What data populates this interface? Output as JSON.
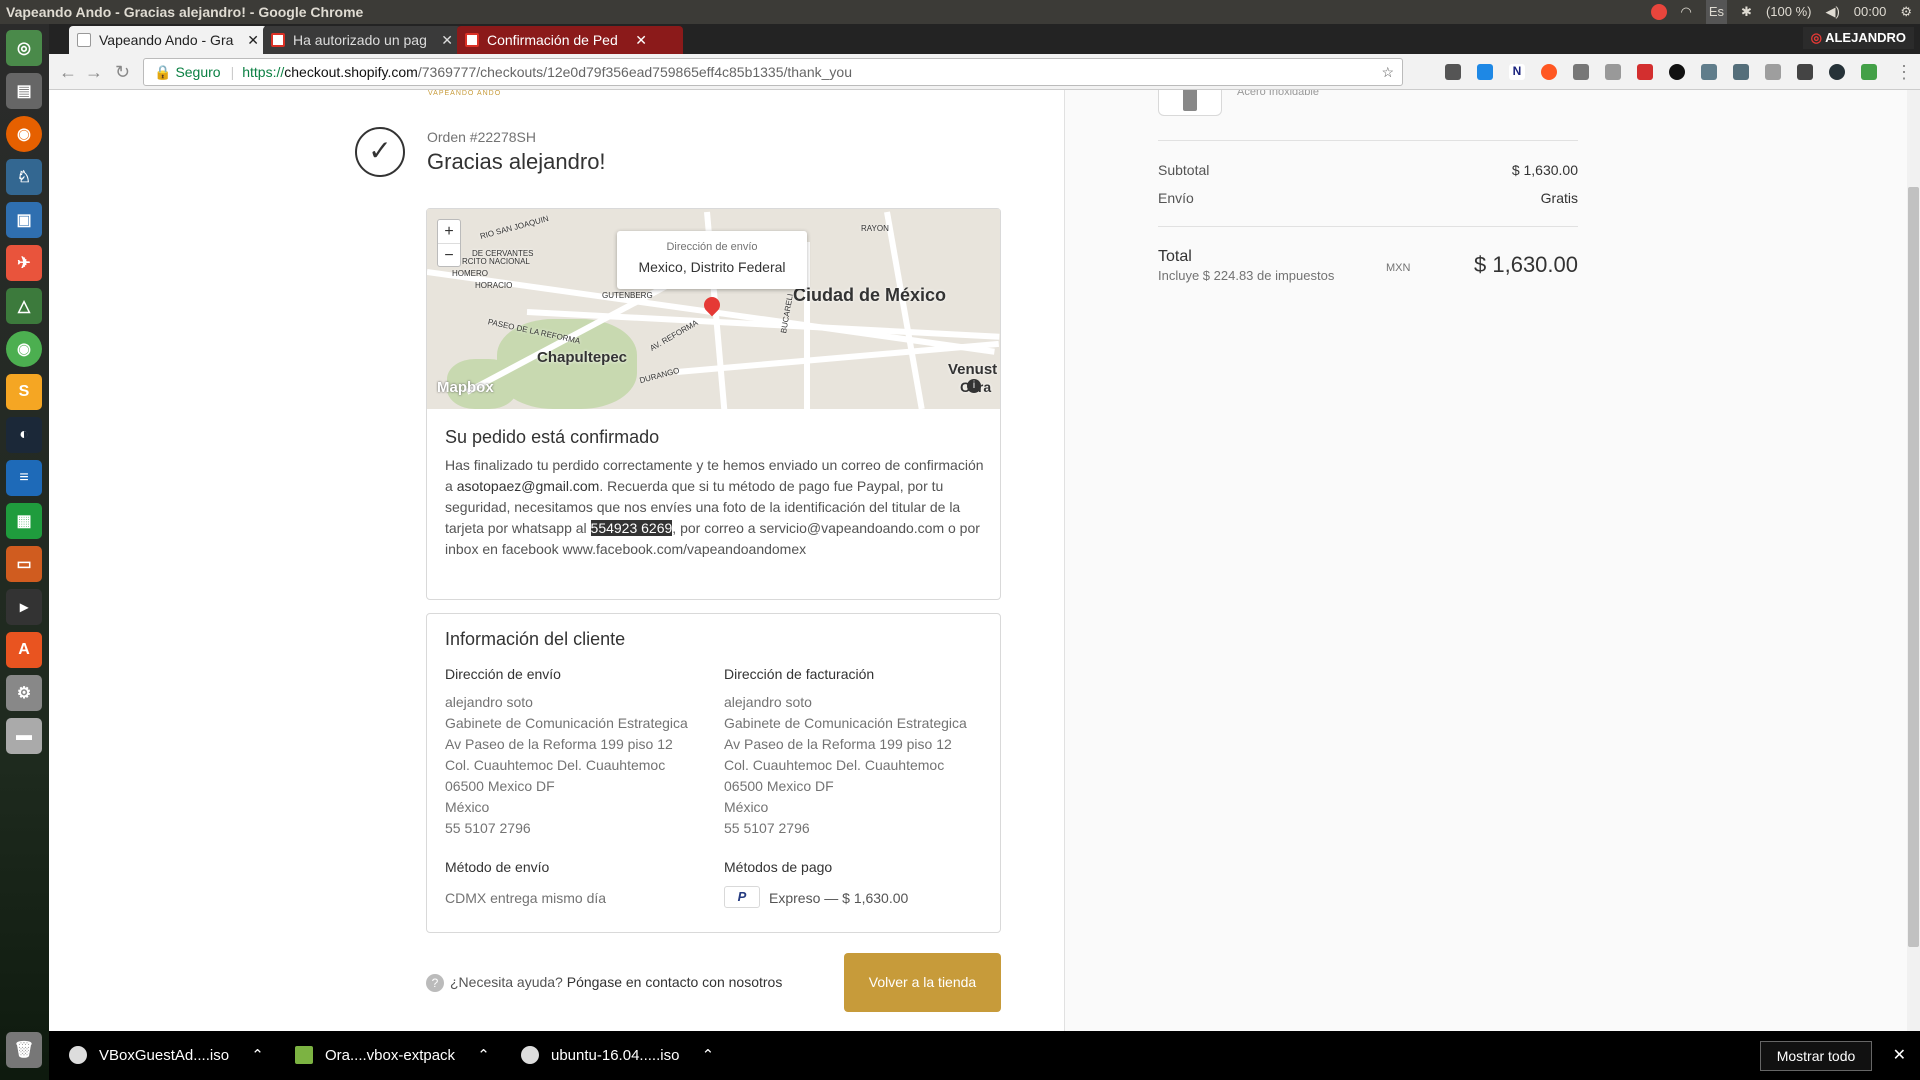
{
  "os": {
    "window_title": "Vapeando Ando - Gracias alejandro! - Google Chrome",
    "keyboard": "Es",
    "battery": "(100 %)",
    "clock": "00:00",
    "user": "ALEJANDRO"
  },
  "browser": {
    "tabs": [
      {
        "label": "Vapeando Ando - Gra",
        "active": true
      },
      {
        "label": "Ha autorizado un pag",
        "active": false
      },
      {
        "label": "Confirmación de Ped",
        "active": false
      }
    ],
    "secure_label": "Seguro",
    "url_scheme": "https://",
    "url_host": "checkout.shopify.com",
    "url_path": "/7369777/checkouts/12e0d79f356ead759865eff4c85b1335/thank_you"
  },
  "page": {
    "logo_text": "VAPEANDO ANDO",
    "order_number": "Orden #22278SH",
    "thanks_title": "Gracias alejandro!",
    "map": {
      "zoom_in": "+",
      "zoom_out": "−",
      "popup_label": "Dirección de envío",
      "popup_value": "Mexico, Distrito Federal",
      "labels": {
        "city": "Ciudad de México",
        "chapultepec": "Chapultepec",
        "venustiano": "Venust",
        "venustiano2": "Cara",
        "cervantes": "DE CERVANTES",
        "nacional": "RCITO NACIONAL",
        "homero": "HOMERO",
        "horacio": "HORACIO",
        "reforma": "PASEO DE LA REFORMA",
        "gutenberg": "GUTENBERG",
        "av_reforma": "AV. REFORMA",
        "durango": "DURANGO",
        "rayon": "RAYON",
        "bucareli": "BUCARELI",
        "san_joaquin": "RIO SAN JOAQUIN"
      },
      "attribution": "Mapbox"
    },
    "confirmed": {
      "title": "Su pedido está confirmado",
      "text_1": "Has finalizado tu perdido correctamente y te hemos enviado un correo de confirmación a ",
      "email": "asotopaez@gmail.com",
      "text_2": ". Recuerda que si tu método de pago fue Paypal, por tu seguridad, necesitamos que nos envíes una foto de la identificación del titular de la tarjeta por whatsapp al ",
      "phone": "554923 6269",
      "text_3": ", por correo a servicio@vapeandoando.com o por inbox en facebook www.facebook.com/vapeandoandomex"
    },
    "customer": {
      "title": "Información del cliente",
      "shipping_heading": "Dirección de envío",
      "billing_heading": "Dirección de facturación",
      "shipping_lines": [
        "alejandro soto",
        "Gabinete de Comunicación Estrategica",
        "Av Paseo de la Reforma 199 piso 12",
        "Col. Cuauhtemoc Del. Cuauhtemoc",
        "06500 Mexico DF",
        "México",
        "55 5107 2796"
      ],
      "billing_lines": [
        "alejandro soto",
        "Gabinete de Comunicación Estrategica",
        "Av Paseo de la Reforma 199 piso 12",
        "Col. Cuauhtemoc Del. Cuauhtemoc",
        "06500 Mexico DF",
        "México",
        "55 5107 2796"
      ],
      "shipping_method_heading": "Método de envío",
      "shipping_method": "CDMX entrega mismo día",
      "payment_heading": "Métodos de pago",
      "payment_icon": "P",
      "payment_method": "Expreso — $ 1,630.00"
    },
    "help_q": "?",
    "help_text": "¿Necesita ayuda?",
    "help_link": "Póngase en contacto con nosotros",
    "return_button": "Volver a la tienda"
  },
  "summary": {
    "product_variant": "Acero Inoxidable",
    "subtotal_label": "Subtotal",
    "subtotal_value": "$ 1,630.00",
    "shipping_label": "Envío",
    "shipping_value": "Gratis",
    "total_label": "Total",
    "taxes_note": "Incluye $ 224.83 de impuestos",
    "currency": "MXN",
    "total_value": "$ 1,630.00"
  },
  "downloads": {
    "items": [
      {
        "label": "VBoxGuestAd....iso"
      },
      {
        "label": "Ora....vbox-extpack"
      },
      {
        "label": "ubuntu-16.04.....iso"
      }
    ],
    "show_all": "Mostrar todo",
    "close": "✕"
  },
  "colors": {
    "accent": "#c79b3a",
    "launcher_bg": "#2b2b2b",
    "os_bar": "#3c3b37"
  }
}
